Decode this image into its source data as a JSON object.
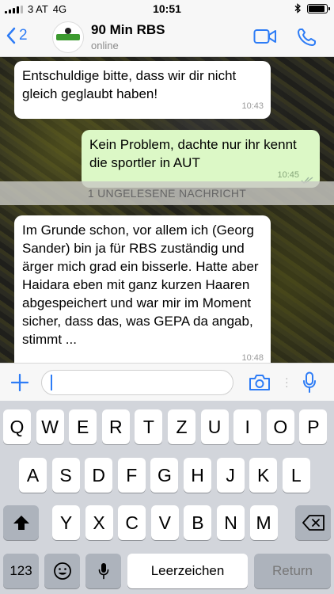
{
  "status_bar": {
    "carrier": "3 AT",
    "network": "4G",
    "time": "10:51",
    "battery_level": 0.9
  },
  "header": {
    "back_count": "2",
    "contact_name": "90 Min RBS",
    "contact_status": "online"
  },
  "messages": [
    {
      "direction": "in",
      "text": "Entschuldige bitte, dass wir dir nicht gleich geglaubt haben!",
      "time": "10:43"
    },
    {
      "direction": "out",
      "text": "Kein Problem, dachte nur ihr kennt die sportler in AUT",
      "time": "10:45",
      "status": "read"
    },
    {
      "direction": "in",
      "text": "Im Grunde schon, vor allem ich (Georg Sander) bin ja für RBS zuständig und ärger mich grad ein bisserle. Hatte aber Haidara eben mit ganz kurzen Haaren abgespeichert und war mir im Moment sicher, dass das, was GEPA da angab, stimmt ...",
      "time": "10:48"
    }
  ],
  "unread_banner": "1 UNGELESENE NACHRICHT",
  "input": {
    "value": "",
    "placeholder": ""
  },
  "keyboard": {
    "row1": [
      "Q",
      "W",
      "E",
      "R",
      "T",
      "Z",
      "U",
      "I",
      "O",
      "P"
    ],
    "row2": [
      "A",
      "S",
      "D",
      "F",
      "G",
      "H",
      "J",
      "K",
      "L"
    ],
    "row3": [
      "Y",
      "X",
      "C",
      "V",
      "B",
      "N",
      "M"
    ],
    "numbers_label": "123",
    "space_label": "Leerzeichen",
    "return_label": "Return"
  },
  "icons": {
    "back": "chevron-left-icon",
    "video": "video-camera-icon",
    "call": "phone-icon",
    "add": "plus-icon",
    "camera": "camera-icon",
    "mic": "microphone-icon",
    "shift": "shift-icon",
    "delete": "backspace-icon",
    "emoji": "emoji-icon",
    "dictation": "microphone-icon",
    "read_receipt": "double-check-icon",
    "bluetooth": "bluetooth-icon",
    "battery": "battery-icon"
  },
  "colors": {
    "accent": "#2d7cf6",
    "outgoing_bubble": "#dcf8c6",
    "incoming_bubble": "#ffffff",
    "keyboard_bg": "#d2d5db"
  }
}
